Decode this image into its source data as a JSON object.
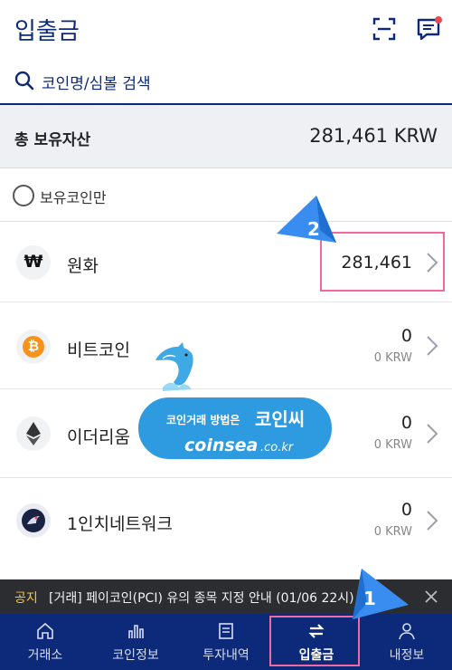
{
  "header": {
    "title": "입출금",
    "scan_icon": "qr-scan-icon",
    "chat_icon": "chat-icon",
    "badge_color": "#e84a4a"
  },
  "search": {
    "placeholder": "코인명/심볼 검색",
    "icon": "search-icon"
  },
  "total": {
    "label": "총 보유자산",
    "value": "281,461 KRW"
  },
  "filter": {
    "label": "보유코인만"
  },
  "assets": [
    {
      "name": "원화",
      "amount": "281,461",
      "krw": "",
      "icon": "won-icon",
      "symbol": "₩"
    },
    {
      "name": "비트코인",
      "amount": "0",
      "krw": "0 KRW",
      "icon": "bitcoin-icon",
      "symbol": "₿"
    },
    {
      "name": "이더리움",
      "amount": "0",
      "krw": "0 KRW",
      "icon": "ethereum-icon"
    },
    {
      "name": "1인치네트워크",
      "amount": "0",
      "krw": "0 KRW",
      "icon": "1inch-icon"
    }
  ],
  "callouts": {
    "step1": "1",
    "step2": "2"
  },
  "watermark": {
    "line1": "코인거래 방법은",
    "line1_big": "코인씨",
    "line2": "coinsea",
    "line2_suffix": ".co.kr"
  },
  "notice": {
    "tag": "공지",
    "text": "[거래] 페이코인(PCI) 유의 종목 지정 안내 (01/06 22시)",
    "close_icon": "close-icon"
  },
  "nav": [
    {
      "label": "거래소",
      "icon": "home-icon"
    },
    {
      "label": "코인정보",
      "icon": "bar-chart-icon"
    },
    {
      "label": "투자내역",
      "icon": "document-icon"
    },
    {
      "label": "입출금",
      "icon": "transfer-icon",
      "active": true
    },
    {
      "label": "내정보",
      "icon": "person-icon"
    }
  ],
  "colors": {
    "brand": "#0d2a7a",
    "highlight": "#f06aa0",
    "callout": "#3a8df0"
  }
}
